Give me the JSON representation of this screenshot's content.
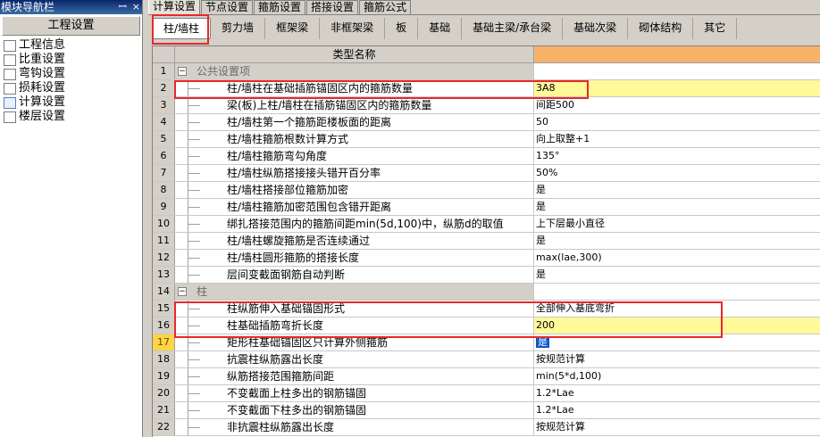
{
  "nav": {
    "title": "模块导航栏",
    "section": "工程设置",
    "items": [
      {
        "label": "工程信息",
        "icon": "folder-icon"
      },
      {
        "label": "比重设置",
        "icon": "scale-icon"
      },
      {
        "label": "弯钩设置",
        "icon": "hook-icon"
      },
      {
        "label": "损耗设置",
        "icon": "chart-icon"
      },
      {
        "label": "计算设置",
        "icon": "calc-icon"
      },
      {
        "label": "楼层设置",
        "icon": "layers-icon"
      }
    ]
  },
  "tabs": [
    "计算设置",
    "节点设置",
    "箍筋设置",
    "搭接设置",
    "箍筋公式"
  ],
  "subtabs": [
    "柱/墙柱",
    "剪力墙",
    "框架梁",
    "非框架梁",
    "板",
    "基础",
    "基础主梁/承台梁",
    "基础次梁",
    "砌体结构",
    "其它"
  ],
  "grid": {
    "header": "类型名称",
    "rows": [
      {
        "num": "1",
        "name": "公共设置项",
        "value": "",
        "group": true
      },
      {
        "num": "2",
        "name": "柱/墙柱在基础插筋锚固区内的箍筋数量",
        "value": "3A8",
        "hl": true
      },
      {
        "num": "3",
        "name": "梁(板)上柱/墙柱在插筋锚固区内的箍筋数量",
        "value": "间距500"
      },
      {
        "num": "4",
        "name": "柱/墙柱第一个箍筋距楼板面的距离",
        "value": "50"
      },
      {
        "num": "5",
        "name": "柱/墙柱箍筋根数计算方式",
        "value": "向上取整+1"
      },
      {
        "num": "6",
        "name": "柱/墙柱箍筋弯勾角度",
        "value": "135°"
      },
      {
        "num": "7",
        "name": "柱/墙柱纵筋搭接接头错开百分率",
        "value": "50%"
      },
      {
        "num": "8",
        "name": "柱/墙柱搭接部位箍筋加密",
        "value": "是"
      },
      {
        "num": "9",
        "name": "柱/墙柱箍筋加密范围包含错开距离",
        "value": "是"
      },
      {
        "num": "10",
        "name": "绑扎搭接范围内的箍筋间距min(5d,100)中，纵筋d的取值",
        "value": "上下层最小直径"
      },
      {
        "num": "11",
        "name": "柱/墙柱螺旋箍筋是否连续通过",
        "value": "是"
      },
      {
        "num": "12",
        "name": "柱/墙柱圆形箍筋的搭接长度",
        "value": "max(lae,300)"
      },
      {
        "num": "13",
        "name": "层间变截面钢筋自动判断",
        "value": "是"
      },
      {
        "num": "14",
        "name": "柱",
        "value": "",
        "group": true
      },
      {
        "num": "15",
        "name": "柱纵筋伸入基础锚固形式",
        "value": "全部伸入基底弯折"
      },
      {
        "num": "16",
        "name": "柱基础插筋弯折长度",
        "value": "200",
        "hl": true
      },
      {
        "num": "17",
        "name": "矩形柱基础锚固区只计算外侧箍筋",
        "value": "是",
        "selected": true
      },
      {
        "num": "18",
        "name": "抗震柱纵筋露出长度",
        "value": "按规范计算"
      },
      {
        "num": "19",
        "name": "纵筋搭接范围箍筋间距",
        "value": "min(5*d,100)"
      },
      {
        "num": "20",
        "name": "不变截面上柱多出的钢筋锚固",
        "value": "1.2*Lae"
      },
      {
        "num": "21",
        "name": "不变截面下柱多出的钢筋锚固",
        "value": "1.2*Lae"
      },
      {
        "num": "22",
        "name": "非抗震柱纵筋露出长度",
        "value": "按规范计算"
      }
    ]
  },
  "colors": {
    "highlight": "#fff99a",
    "annotation": "#e8282b",
    "header_value": "#f7b26a"
  }
}
